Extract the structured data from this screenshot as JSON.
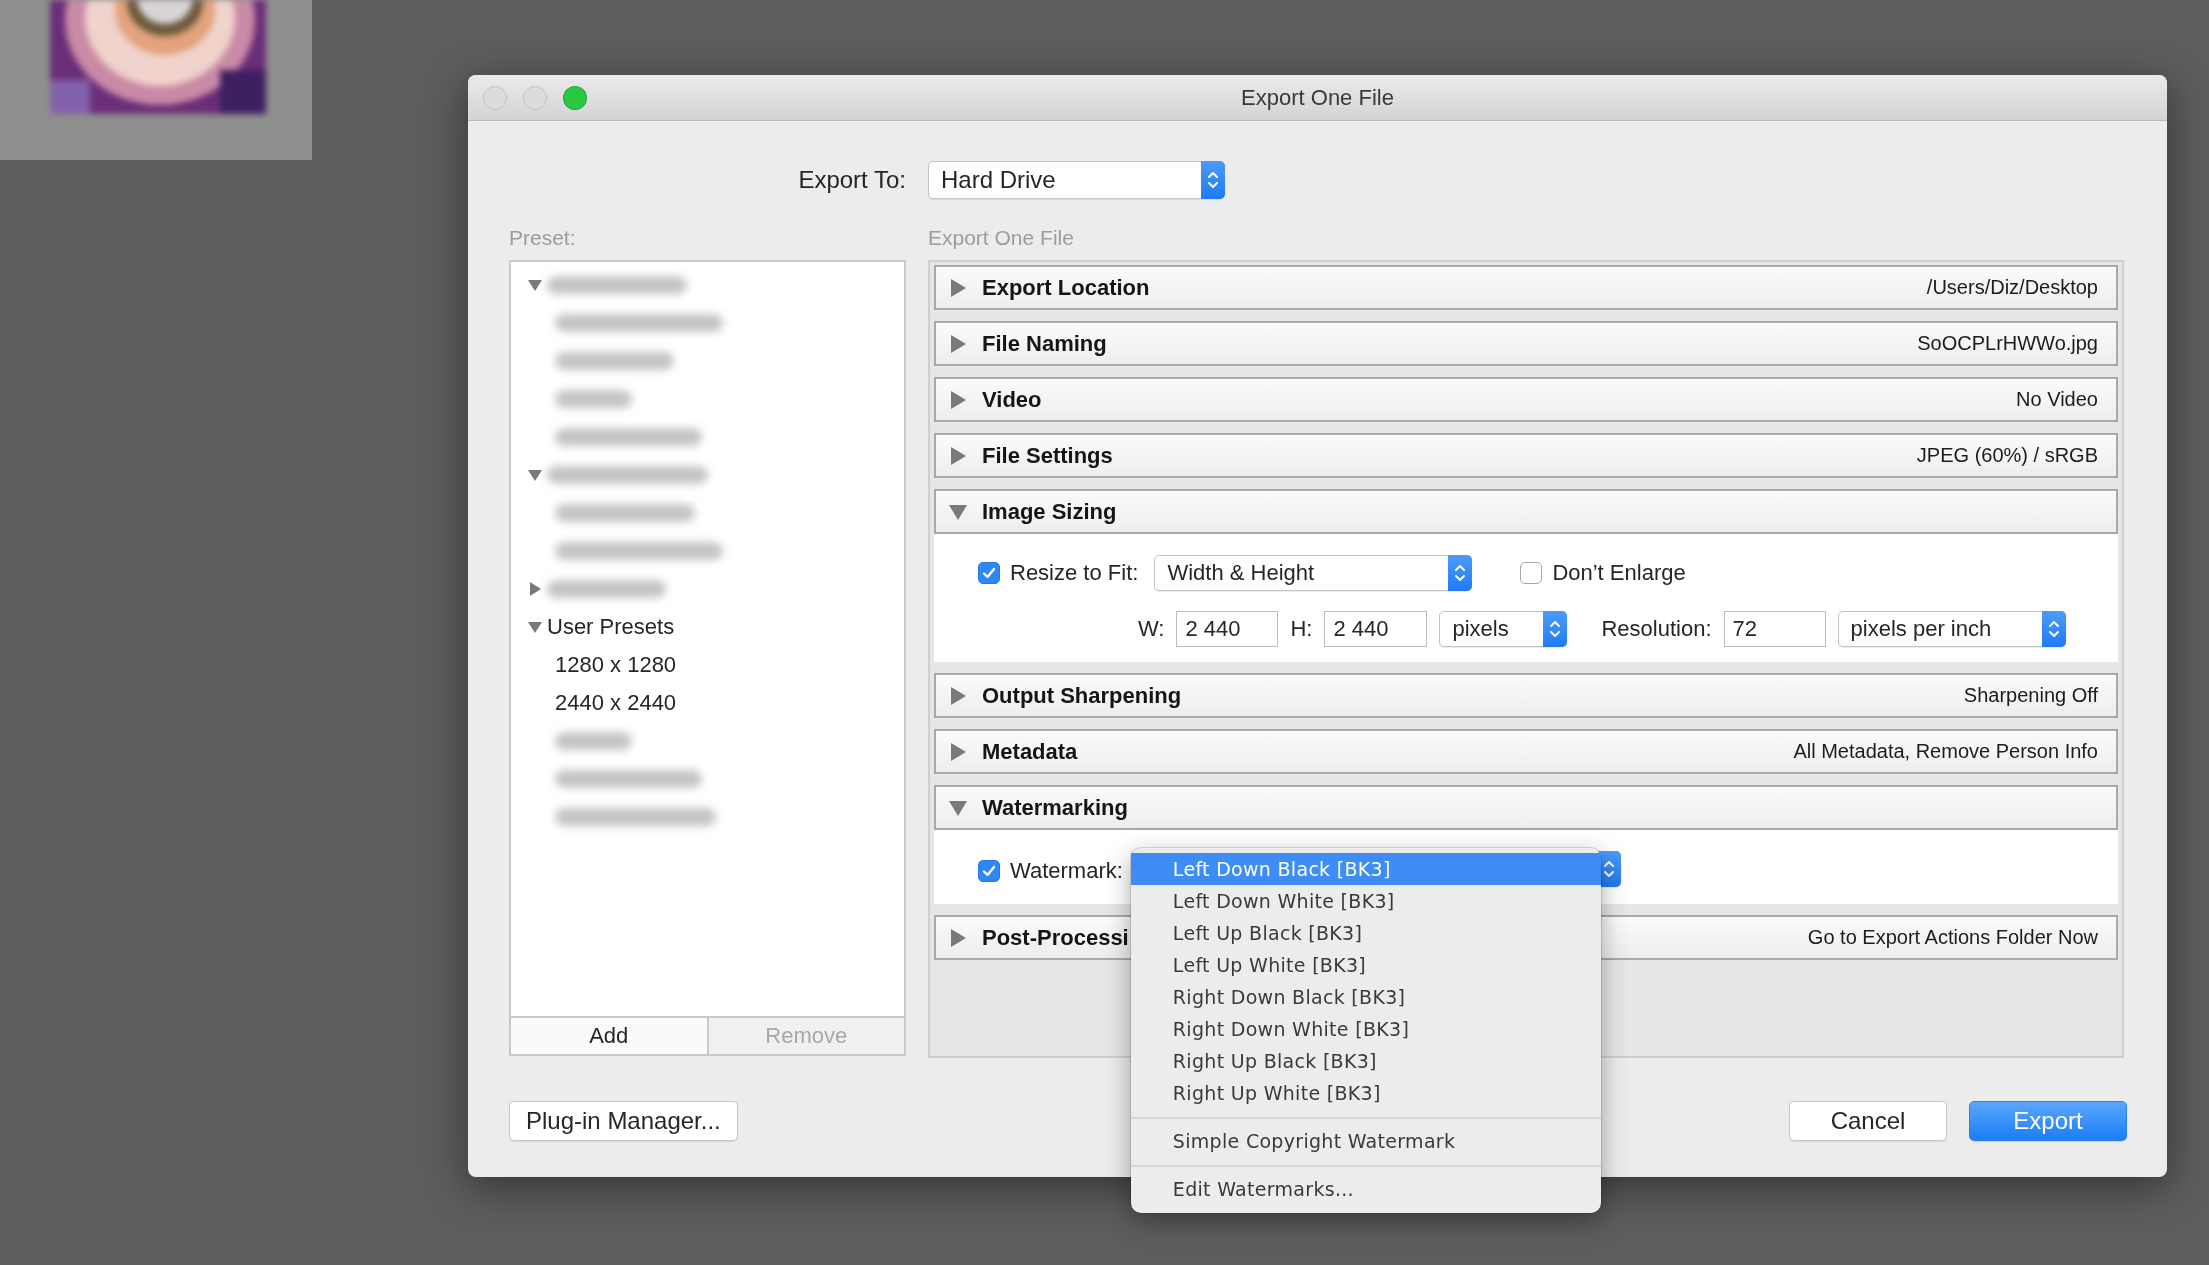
{
  "window": {
    "title": "Export One File",
    "traffic_lights": [
      {
        "kind": "close",
        "disabled": true
      },
      {
        "kind": "minimize",
        "disabled": true
      },
      {
        "kind": "zoom",
        "disabled": false
      }
    ]
  },
  "export_to": {
    "label": "Export To:",
    "value": "Hard Drive"
  },
  "preset": {
    "label": "Preset:",
    "tree": [
      {
        "kind": "blurred",
        "expanded": true,
        "children": [
          {
            "kind": "blurred"
          },
          {
            "kind": "blurred"
          },
          {
            "kind": "blurred"
          },
          {
            "kind": "blurred"
          }
        ]
      },
      {
        "kind": "blurred",
        "expanded": true,
        "children": [
          {
            "kind": "blurred"
          },
          {
            "kind": "blurred"
          }
        ]
      },
      {
        "kind": "blurred",
        "expanded": false
      },
      {
        "kind": "text",
        "label": "User Presets",
        "expanded": true,
        "children": [
          {
            "kind": "text",
            "label": "1280 x 1280"
          },
          {
            "kind": "text",
            "label": "2440 x 2440"
          },
          {
            "kind": "blurred"
          },
          {
            "kind": "blurred"
          },
          {
            "kind": "blurred"
          }
        ]
      }
    ],
    "buttons": [
      {
        "label": "Add",
        "disabled": false
      },
      {
        "label": "Remove",
        "disabled": true
      }
    ]
  },
  "panel_title": "Export One File",
  "sections": [
    {
      "kind": "summary",
      "title": "Export Location",
      "expanded": false,
      "summary": "/Users/Diz/Desktop"
    },
    {
      "kind": "summary",
      "title": "File Naming",
      "expanded": false,
      "summary": "SoOCPLrHWWo.jpg"
    },
    {
      "kind": "summary",
      "title": "Video",
      "expanded": false,
      "summary": "No Video"
    },
    {
      "kind": "summary",
      "title": "File Settings",
      "expanded": false,
      "summary": "JPEG (60%) / sRGB"
    },
    {
      "kind": "image_sizing",
      "title": "Image Sizing",
      "expanded": true,
      "resize": {
        "label": "Resize to Fit:",
        "checked": true,
        "value": "Width & Height"
      },
      "dont_enlarge": {
        "label": "Don’t Enlarge",
        "checked": false
      },
      "width": {
        "label": "W:",
        "value": "2 440"
      },
      "height": {
        "label": "H:",
        "value": "2 440"
      },
      "units": "pixels",
      "resolution": {
        "label": "Resolution:",
        "value": "72",
        "units": "pixels per inch"
      }
    },
    {
      "kind": "summary",
      "title": "Output Sharpening",
      "expanded": false,
      "summary": "Sharpening Off"
    },
    {
      "kind": "summary",
      "title": "Metadata",
      "expanded": false,
      "summary": "All Metadata, Remove Person Info"
    },
    {
      "kind": "watermarking",
      "title": "Watermarking",
      "expanded": true,
      "watermark": {
        "label": "Watermark:",
        "checked": true
      },
      "menu": [
        [
          {
            "label": "Left Down Black [BK3]",
            "selected": true
          },
          {
            "label": "Left Down White [BK3]",
            "selected": false
          },
          {
            "label": "Left Up Black [BK3]",
            "selected": false
          },
          {
            "label": "Left Up White [BK3]",
            "selected": false
          },
          {
            "label": "Right Down Black [BK3]",
            "selected": false
          },
          {
            "label": "Right Down White [BK3]",
            "selected": false
          },
          {
            "label": "Right Up Black [BK3]",
            "selected": false
          },
          {
            "label": "Right Up White [BK3]",
            "selected": false
          }
        ],
        [
          {
            "label": "Simple Copyright Watermark",
            "selected": false
          }
        ],
        [
          {
            "label": "Edit Watermarks...",
            "selected": false
          }
        ]
      ]
    },
    {
      "kind": "summary",
      "title": "Post-Processi",
      "expanded": false,
      "summary": "Go to Export Actions Folder Now"
    }
  ],
  "buttons": [
    {
      "kind": "plain",
      "label": "Plug-in Manager..."
    },
    {
      "kind": "plain",
      "label": "Cancel"
    },
    {
      "kind": "default",
      "label": "Export"
    }
  ]
}
